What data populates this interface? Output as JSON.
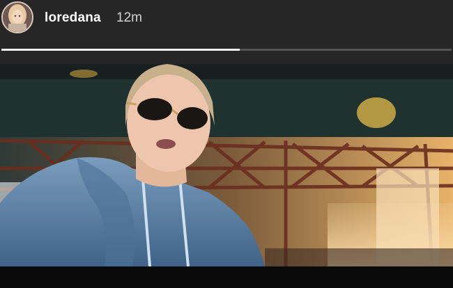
{
  "story": {
    "username": "loredana",
    "time_ago": "12m",
    "progress_percent": 53
  },
  "icons": {
    "avatar": "profile-photo"
  },
  "colors": {
    "background": "#262626",
    "progress_track": "#555555",
    "progress_fill": "#f2f2f2"
  }
}
